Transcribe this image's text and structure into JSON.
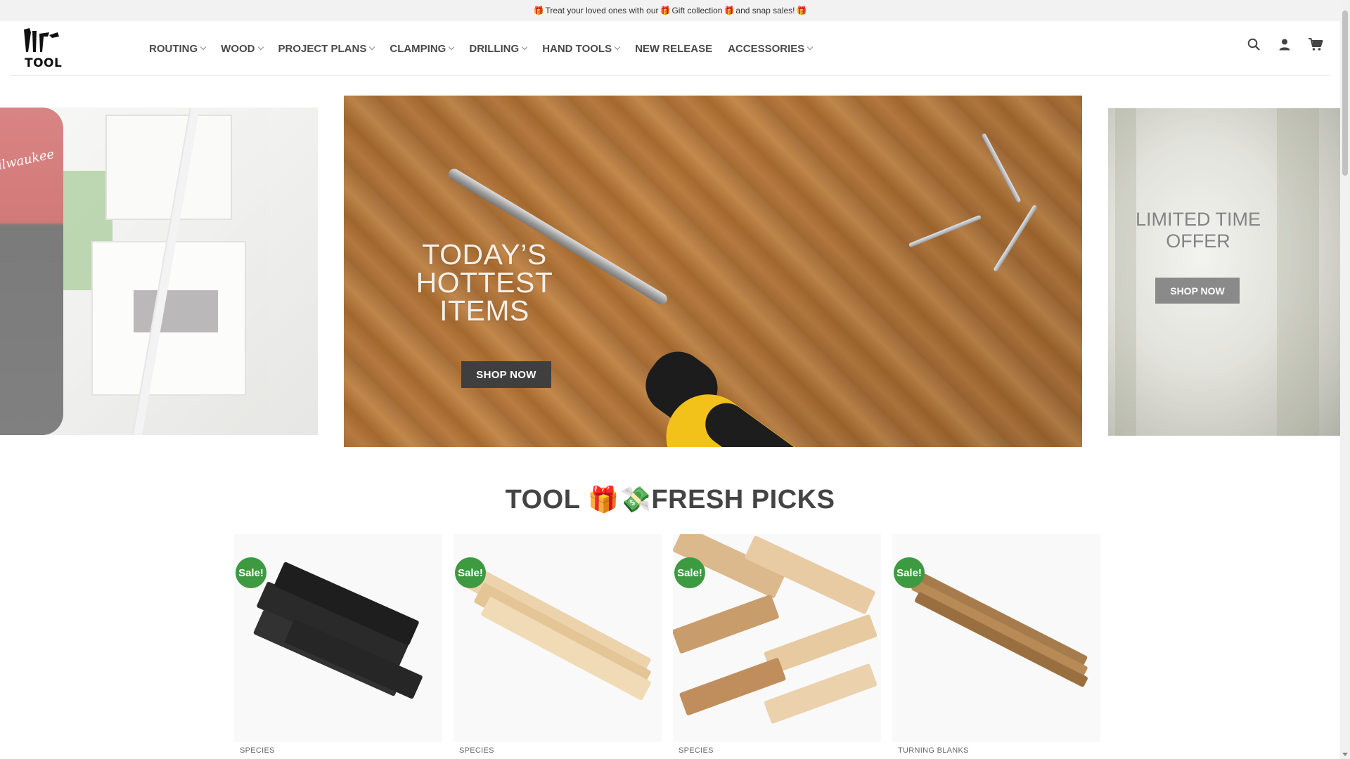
{
  "announcement": {
    "part1": "Treat your loved ones with our",
    "part2": "Gift collection",
    "part3": "and snap sales!",
    "gift_icon": "🎁"
  },
  "brand": {
    "logo_text": "TOOL"
  },
  "nav": {
    "items": [
      {
        "label": "ROUTING",
        "dropdown": true
      },
      {
        "label": "WOOD",
        "dropdown": true
      },
      {
        "label": "PROJECT PLANS",
        "dropdown": true
      },
      {
        "label": "CLAMPING",
        "dropdown": true
      },
      {
        "label": "DRILLING",
        "dropdown": true
      },
      {
        "label": "HAND TOOLS",
        "dropdown": true
      },
      {
        "label": "NEW RELEASE",
        "dropdown": false
      },
      {
        "label": "ACCESSORIES",
        "dropdown": true
      }
    ]
  },
  "header_icons": [
    "search-icon",
    "account-icon",
    "cart-icon"
  ],
  "slider": {
    "main": {
      "title": "TODAY’S HOTTEST ITEMS",
      "button": "SHOP NOW"
    },
    "right": {
      "title": "LIMITED TIME OFFER",
      "button": "SHOP NOW"
    },
    "left": {
      "brand_print": "Milwaukee"
    }
  },
  "section": {
    "title_prefix": "TOOL",
    "emoji1": "🎁",
    "emoji2": "💸",
    "title_suffix": "FRESH PICKS"
  },
  "products": [
    {
      "badge": "Sale!",
      "category": "SPECIES"
    },
    {
      "badge": "Sale!",
      "category": "SPECIES"
    },
    {
      "badge": "Sale!",
      "category": "SPECIES"
    },
    {
      "badge": "Sale!",
      "category": "TURNING BLANKS"
    }
  ],
  "colors": {
    "sale_badge": "#3d9a41",
    "button_dark": "#3f3f3f",
    "topbar_bg": "#f2f2f2"
  }
}
